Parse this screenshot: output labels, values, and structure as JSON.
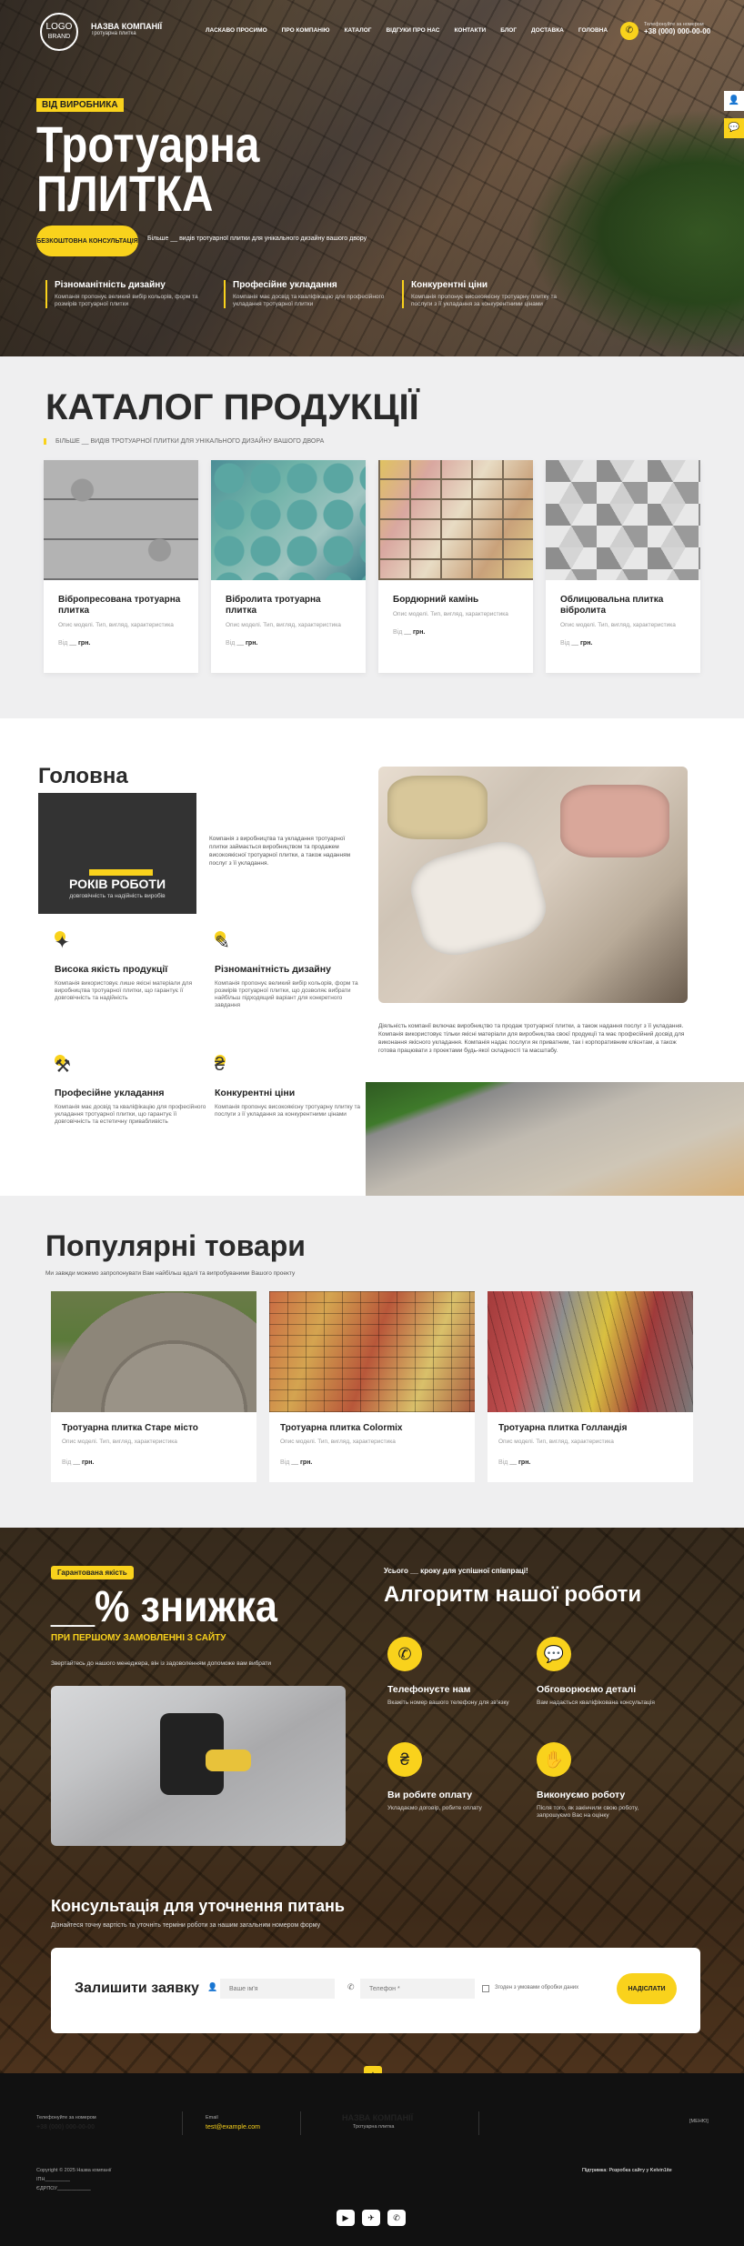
{
  "header": {
    "logo_top": "LOGO",
    "logo_bottom": "BRAND",
    "company": "НАЗВА КОМПАНІЇ",
    "company_sub": "Тротуарна плитка",
    "nav": [
      "ЛАСКАВО ПРОСИМО",
      "ПРО КОМПАНІЮ",
      "КАТАЛОГ",
      "ВІДГУКИ ПРО НАС",
      "КОНТАКТИ",
      "БЛОГ",
      "ДОСТАВКА",
      "ГОЛОВНА"
    ],
    "phone_label": "Телефонуйте за номером",
    "phone": "+38 (000) 000-00-00",
    "side_icons": [
      "user-icon",
      "chat-icon"
    ]
  },
  "hero": {
    "badge": "ВІД ВИРОБНИКА",
    "title1": "Тротуарна",
    "title2": "ПЛИТКА",
    "button": "БЕЗКОШТОВНА КОНСУЛЬТАЦІЯ",
    "sub": "Більше __ видів тротуарної плитки для унікального дизайну вашого двору",
    "features": [
      {
        "t": "Різноманітність дизайну",
        "d": "Компанія пропонує великий вибір кольорів, форм та розмірів тротуарної плитки"
      },
      {
        "t": "Професійне укладання",
        "d": "Компанія має досвід та кваліфікацію для професійного укладання тротуарної плитки"
      },
      {
        "t": "Конкурентні ціни",
        "d": "Компанія пропонує високоякісну тротуарну плитку та послуги з її укладання за конкурентними цінами"
      }
    ]
  },
  "catalog": {
    "title": "КАТАЛОГ ПРОДУКЦІЇ",
    "sub": "БІЛЬШЕ __ ВИДІВ ТРОТУАРНОЇ ПЛИТКИ ДЛЯ УНІКАЛЬНОГО ДИЗАЙНУ ВАШОГО ДВОРА",
    "items": [
      {
        "t": "Вібропресована тротуарна плитка",
        "d": "Опис моделі. Тип, вигляд, характеристика",
        "from": "Від",
        "price": "__ грн."
      },
      {
        "t": "Вібролита тротуарна плитка",
        "d": "Опис моделі. Тип, вигляд, характеристика",
        "from": "Від",
        "price": "__ грн."
      },
      {
        "t": "Бордюрний камінь",
        "d": "Опис моделі. Тип, вигляд, характеристика",
        "from": "Від",
        "price": "__ грн."
      },
      {
        "t": "Облицювальна плитка вібролита",
        "d": "Опис моделі. Тип, вигляд, характеристика",
        "from": "Від",
        "price": "__ грн."
      }
    ]
  },
  "about": {
    "title": "Головна",
    "years": "РОКІВ РОБОТИ",
    "years_sub": "довговічність та надійність виробів",
    "text1": "Компанія з виробництва та укладання тротуарної плитки займається виробництвом та продажем високоякісної тротуарної плитки, а також наданням послуг з її укладання.",
    "text2": "Діяльність компанії включає виробництво та продаж тротуарної плитки, а також надання послуг з її укладання. Компанія використовує тільки якісні матеріали для виробництва своєї продукції та має професійний досвід для виконання якісного укладання. Компанія надає послуги як приватним, так і корпоративним клієнтам, а також готова працювати з проектами будь-якої складності та масштабу.",
    "adv": [
      {
        "icon": "quality-icon",
        "t": "Висока якість продукції",
        "d": "Компанія використовує лише якісні матеріали для виробництва тротуарної плитки, що гарантує її довговічність та надійність"
      },
      {
        "icon": "design-icon",
        "t": "Різноманітність дизайну",
        "d": "Компанія пропонує великий вибір кольорів, форм та розмірів тротуарної плитки, що дозволяє вибрати найбільш підходящий варіант для конкретного завдання"
      },
      {
        "icon": "tools-icon",
        "t": "Професійне укладання",
        "d": "Компанія має досвід та кваліфікацію для професійного укладання тротуарної плитки, що гарантує її довговічність та естетичну привабливість"
      },
      {
        "icon": "price-icon",
        "t": "Конкурентні ціни",
        "d": "Компанія пропонує високоякісну тротуарну плитку та послуги з її укладання за конкурентними цінами"
      }
    ]
  },
  "popular": {
    "title": "Популярні товари",
    "sub": "Ми завжди можемо запропонувати Вам найбільш вдалі та випробуваними Вашого проекту",
    "items": [
      {
        "t": "Тротуарна плитка Старе місто",
        "d": "Опис моделі. Тип, вигляд, характеристика",
        "from": "Від",
        "price": "__ грн."
      },
      {
        "t": "Тротуарна плитка Colormix",
        "d": "Опис моделі. Тип, вигляд, характеристика",
        "from": "Від",
        "price": "__ грн."
      },
      {
        "t": "Тротуарна плитка Голландія",
        "d": "Опис моделі. Тип, вигляд, характеристика",
        "from": "Від",
        "price": "__ грн."
      }
    ]
  },
  "promo": {
    "badge": "Гарантована якість",
    "discount": "__% знижка",
    "discount_sub": "ПРИ ПЕРШОМУ ЗАМОВЛЕННІ З САЙТУ",
    "text": "Звертайтесь до нашого менеджера, він із задоволенням допоможе вам вибрати",
    "alg_pre": "Усього __ кроку для успішної співпраці!",
    "alg_title": "Алгоритм нашої роботи",
    "steps": [
      {
        "icon": "phone-icon",
        "t": "Телефонуєте нам",
        "d": "Вкажіть номер вашого телефону для зв'язку"
      },
      {
        "icon": "chat-icon",
        "t": "Обговорюємо деталі",
        "d": "Вам надається кваліфікована консультація"
      },
      {
        "icon": "wallet-icon",
        "t": "Ви робите оплату",
        "d": "Укладаємо договір, робите оплату"
      },
      {
        "icon": "hand-icon",
        "t": "Виконуємо роботу",
        "d": "Після того, як закінчили свою роботу, запрошуємо Вас на оцінку"
      }
    ],
    "consult_title": "Консультація для уточнення питань",
    "consult_sub": "Дізнайтеся точну вартість та уточніть терміни роботи за нашим загальним номером форму"
  },
  "form": {
    "title": "Залишити заявку",
    "name_ph": "Ваше ім'я",
    "phone_ph": "Телефон *",
    "agree": "Згоден з умовами обробки даних",
    "send": "НАДІСЛАТИ"
  },
  "footer": {
    "phone_label": "Телефонуйте за номером",
    "phone": "+38 (000) 000-00-00",
    "email_label": "Email",
    "email": "test@example.com",
    "company": "НАЗВА КОМПАНІЇ",
    "company_sub": "Тротуарна плитка",
    "lang": "[МЕНЮ]",
    "copyright": "Copyright © 2025 Назва компанії",
    "edrpou": "ЄДРПОУ____________",
    "inn": "ІПН_________",
    "made": "Підтримка: Розробка сайту у Kelvin1ite",
    "social": [
      "youtube-icon",
      "telegram-icon",
      "viber-icon"
    ]
  }
}
